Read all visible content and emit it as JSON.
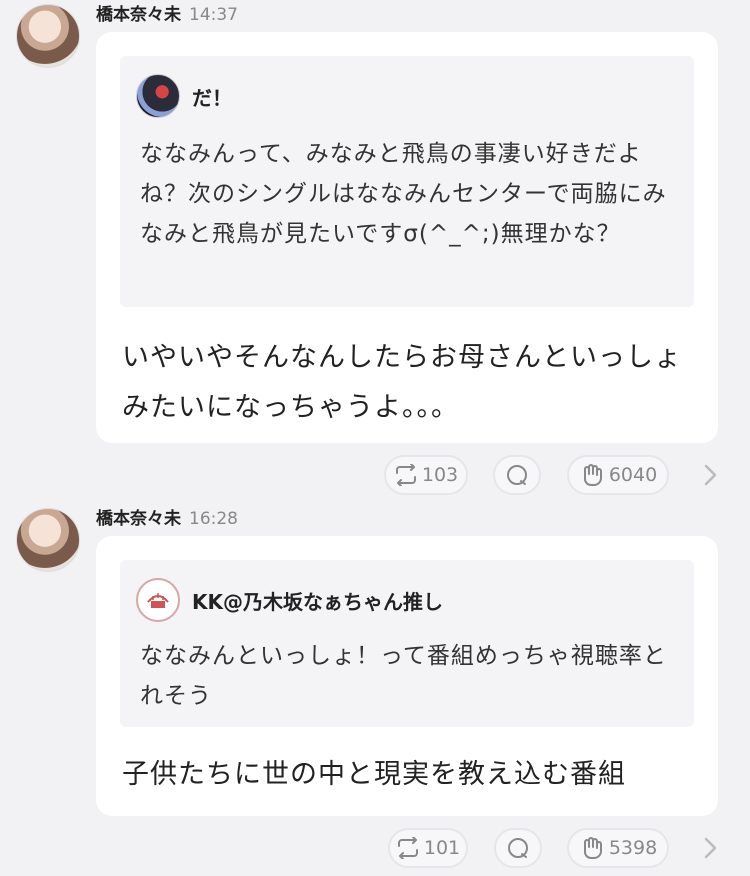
{
  "posts": [
    {
      "author": "橋本奈々未",
      "time": "14:37",
      "quote": {
        "name": "だ！",
        "text": "ななみんって、みなみと飛鳥の事凄い好きだよね？次のシングルはななみんセンターで両脇にみなみと飛鳥が見たいですσ(^_^;)無理かな？"
      },
      "reply": "いやいやそんなんしたらお母さんといっしょみたいになっちゃうよ。。。",
      "actions": {
        "retweet_count": "103",
        "like_count": "6040"
      }
    },
    {
      "author": "橋本奈々未",
      "time": "16:28",
      "quote": {
        "name": "KK@乃木坂なぁちゃん推し",
        "text": "ななみんといっしょ！って番組めっちゃ視聴率とれそう"
      },
      "reply": "子供たちに世の中と現実を教え込む番組",
      "actions": {
        "retweet_count": "101",
        "like_count": "5398"
      }
    }
  ],
  "icons": [
    "repost-icon",
    "comment-icon",
    "applause-icon",
    "chevron-right-icon"
  ],
  "colors": {
    "background": "#f2f2f4",
    "card": "#ffffff",
    "quote_bg": "#f4f4f6",
    "muted": "#888888"
  }
}
